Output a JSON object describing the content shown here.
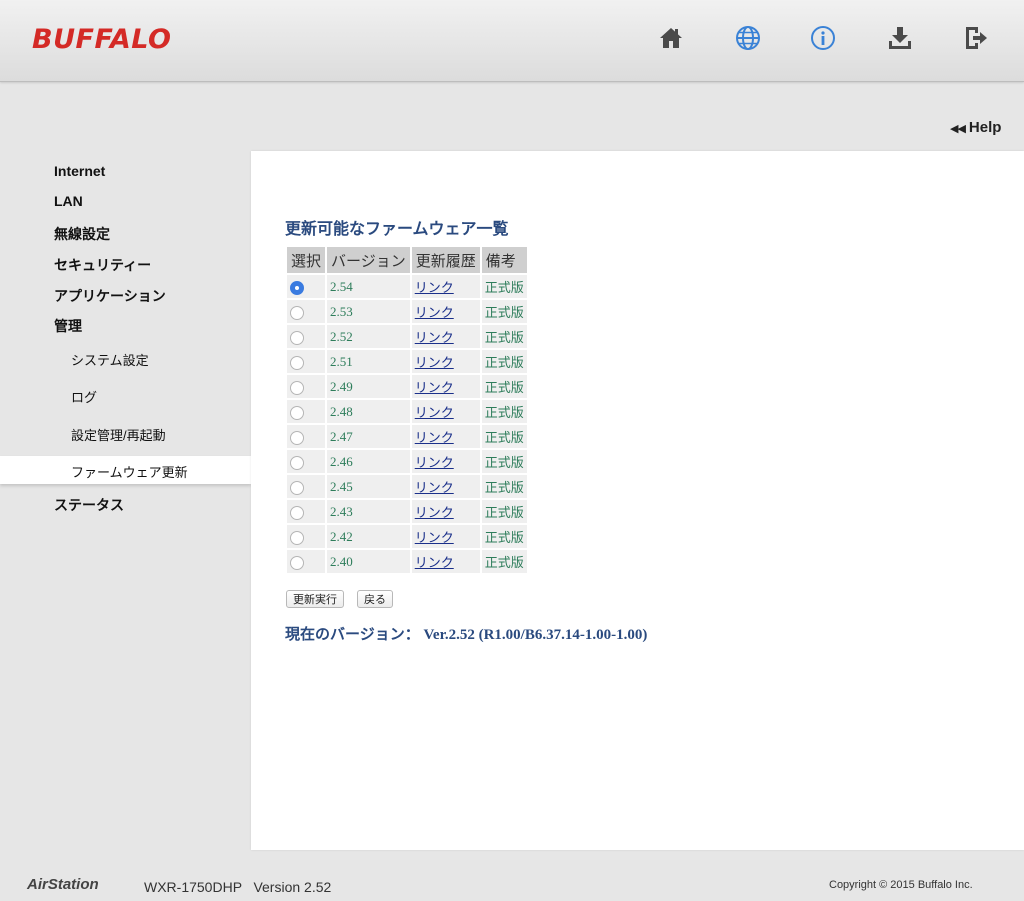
{
  "header": {
    "logo": "BUFFALO",
    "icons": [
      "home-icon",
      "globe-icon",
      "info-icon",
      "download-icon",
      "logout-icon"
    ]
  },
  "help_label": "Help",
  "sidebar": {
    "items": [
      {
        "label": "Internet"
      },
      {
        "label": "LAN"
      },
      {
        "label": "無線設定"
      },
      {
        "label": "セキュリティー"
      },
      {
        "label": "アプリケーション"
      },
      {
        "label": "管理"
      }
    ],
    "sub_items": [
      {
        "label": "システム設定"
      },
      {
        "label": "ログ"
      },
      {
        "label": "設定管理/再起動"
      },
      {
        "label": "ファームウェア更新",
        "active": true
      }
    ],
    "status_label": "ステータス"
  },
  "main": {
    "title": "更新可能なファームウェア一覧",
    "columns": [
      "選択",
      "バージョン",
      "更新履歴",
      "備考"
    ],
    "rows": [
      {
        "selected": true,
        "version": "2.54",
        "link": "リンク",
        "note": "正式版"
      },
      {
        "selected": false,
        "version": "2.53",
        "link": "リンク",
        "note": "正式版"
      },
      {
        "selected": false,
        "version": "2.52",
        "link": "リンク",
        "note": "正式版"
      },
      {
        "selected": false,
        "version": "2.51",
        "link": "リンク",
        "note": "正式版"
      },
      {
        "selected": false,
        "version": "2.49",
        "link": "リンク",
        "note": "正式版"
      },
      {
        "selected": false,
        "version": "2.48",
        "link": "リンク",
        "note": "正式版"
      },
      {
        "selected": false,
        "version": "2.47",
        "link": "リンク",
        "note": "正式版"
      },
      {
        "selected": false,
        "version": "2.46",
        "link": "リンク",
        "note": "正式版"
      },
      {
        "selected": false,
        "version": "2.45",
        "link": "リンク",
        "note": "正式版"
      },
      {
        "selected": false,
        "version": "2.43",
        "link": "リンク",
        "note": "正式版"
      },
      {
        "selected": false,
        "version": "2.42",
        "link": "リンク",
        "note": "正式版"
      },
      {
        "selected": false,
        "version": "2.40",
        "link": "リンク",
        "note": "正式版"
      }
    ],
    "update_button": "更新実行",
    "back_button": "戻る",
    "current_version": "現在のバージョン： Ver.2.52 (R1.00/B6.37.14-1.00-1.00)"
  },
  "footer": {
    "brand": "AirStation",
    "model": "WXR-1750DHP   Version 2.52",
    "copyright": "Copyright © 2015 Buffalo Inc."
  },
  "colors": {
    "brand_red": "#d42a26",
    "title_blue": "#2a4a7f",
    "version_green": "#2e7d5b",
    "radio_blue": "#3a7be0"
  }
}
